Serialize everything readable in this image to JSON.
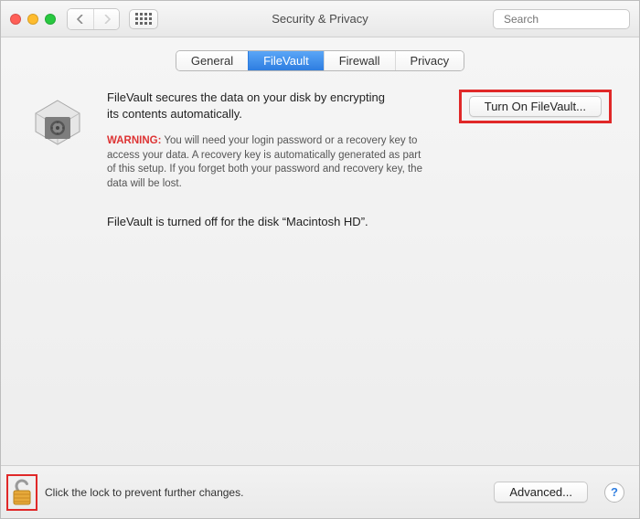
{
  "window": {
    "title": "Security & Privacy"
  },
  "search": {
    "placeholder": "Search"
  },
  "tabs": {
    "general": "General",
    "filevault": "FileVault",
    "firewall": "Firewall",
    "privacy": "Privacy"
  },
  "filevault": {
    "description": "FileVault secures the data on your disk by encrypting its contents automatically.",
    "turn_on_label": "Turn On FileVault...",
    "warning_prefix": "WARNING:",
    "warning_body": " You will need your login password or a recovery key to access your data. A recovery key is automatically generated as part of this setup. If you forget both your password and recovery key, the data will be lost.",
    "status": "FileVault is turned off for the disk “Macintosh HD”."
  },
  "footer": {
    "lock_hint": "Click the lock to prevent further changes.",
    "advanced_label": "Advanced...",
    "help_label": "?"
  }
}
